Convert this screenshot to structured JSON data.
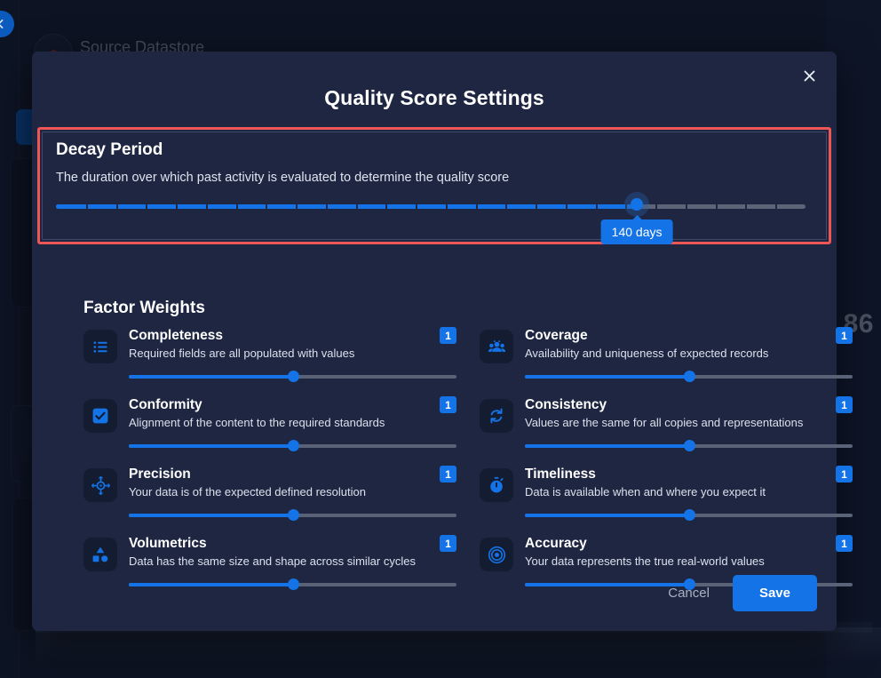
{
  "background": {
    "page_title": "Source Datastore",
    "score": "86",
    "collapse_icon": "chevron-left-icon"
  },
  "modal": {
    "title": "Quality Score Settings",
    "close_icon": "close-icon",
    "decay": {
      "title": "Decay Period",
      "description": "The duration over which past activity is evaluated to determine the quality score",
      "value_label": "140 days",
      "value": 140,
      "min": 0,
      "max": 180,
      "percent": 77.5,
      "tick_count": 25,
      "highlight_color": "#ee5555",
      "accent_color": "#1473e6"
    },
    "factors_title": "Factor Weights",
    "factors": [
      {
        "name": "Completeness",
        "description": "Required fields are all populated with values",
        "weight": "1",
        "percent": 50,
        "icon": "list-icon"
      },
      {
        "name": "Coverage",
        "description": "Availability and uniqueness of expected records",
        "weight": "1",
        "percent": 50,
        "icon": "people-group-icon"
      },
      {
        "name": "Conformity",
        "description": "Alignment of the content to the required standards",
        "weight": "1",
        "percent": 50,
        "icon": "checkbox-icon"
      },
      {
        "name": "Consistency",
        "description": "Values are the same for all copies and representations",
        "weight": "1",
        "percent": 50,
        "icon": "sync-refresh-icon"
      },
      {
        "name": "Precision",
        "description": "Your data is of the expected defined resolution",
        "weight": "1",
        "percent": 50,
        "icon": "crosshair-icon"
      },
      {
        "name": "Timeliness",
        "description": "Data is available when and where you expect it",
        "weight": "1",
        "percent": 50,
        "icon": "stopwatch-icon"
      },
      {
        "name": "Volumetrics",
        "description": "Data has the same size and shape across similar cycles",
        "weight": "1",
        "percent": 50,
        "icon": "shapes-icon"
      },
      {
        "name": "Accuracy",
        "description": "Your data represents the true real-world values",
        "weight": "1",
        "percent": 50,
        "icon": "target-rings-icon"
      }
    ],
    "cancel_label": "Cancel",
    "save_label": "Save"
  }
}
